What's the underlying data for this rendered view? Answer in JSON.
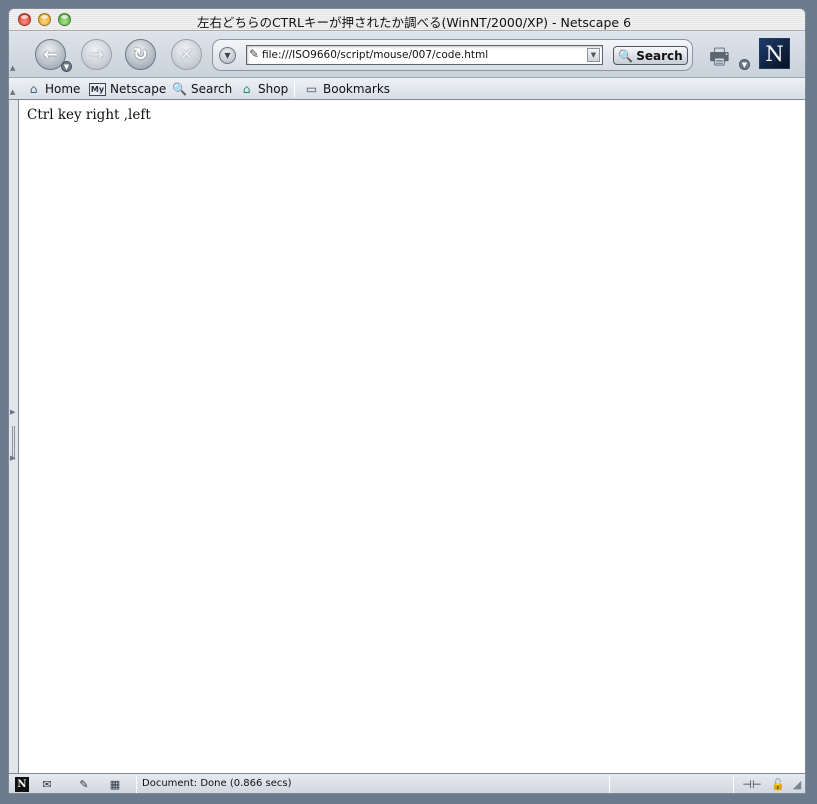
{
  "window": {
    "title": "左右どちらのCTRLキーが押されたか調べる(WinNT/2000/XP) - Netscape 6"
  },
  "navigation": {
    "back_icon": "back-arrow-icon",
    "forward_icon": "forward-arrow-icon",
    "reload_icon": "reload-icon",
    "stop_icon": "stop-icon"
  },
  "urlbar": {
    "value": "file:///ISO9660/script/mouse/007/code.html",
    "search_label": "Search"
  },
  "personal_toolbar": {
    "items": [
      {
        "label": "Home",
        "icon": "home-icon"
      },
      {
        "label": "Netscape",
        "icon": "my-netscape-icon"
      },
      {
        "label": "Search",
        "icon": "search-icon"
      },
      {
        "label": "Shop",
        "icon": "shop-icon"
      }
    ],
    "bookmarks_label": "Bookmarks"
  },
  "page": {
    "text": "Ctrl key right ,left"
  },
  "status": {
    "text": "Document: Done (0.866 secs)"
  },
  "colors": {
    "desktop": "#6b7a8c",
    "chrome": "#dde3ea",
    "logo": "#1f3c6e"
  }
}
